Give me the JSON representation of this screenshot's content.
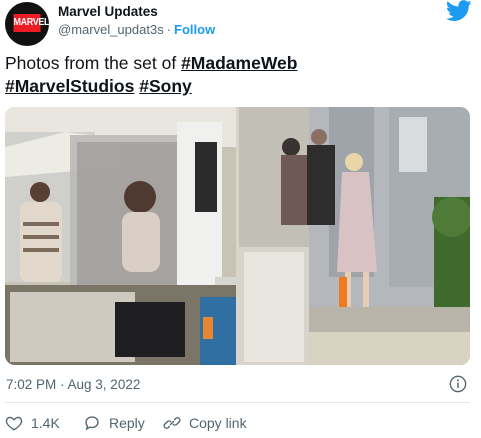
{
  "author": {
    "display_name": "Marvel Updates",
    "handle": "@marvel_updat3s",
    "separator": "·",
    "follow_label": "Follow",
    "avatar_logo_text": "MARVEL"
  },
  "tweet": {
    "text_lead": "Photos from the set of ",
    "hashtags": [
      "#MadameWeb",
      "#MarvelStudios",
      "#Sony"
    ],
    "timestamp": "7:02 PM · Aug 3, 2022"
  },
  "actions": {
    "like_count": "1.4K",
    "reply_label": "Reply",
    "copy_link_label": "Copy link"
  },
  "colors": {
    "accent": "#1d9bf0",
    "marvel_red": "#ec1d24",
    "secondary_text": "#536471",
    "like_color": "#e0245e"
  },
  "icons": {
    "brand": "twitter-bird-icon",
    "info": "info-icon",
    "like": "heart-icon",
    "reply": "reply-bubble-icon",
    "copy_link": "link-icon"
  }
}
